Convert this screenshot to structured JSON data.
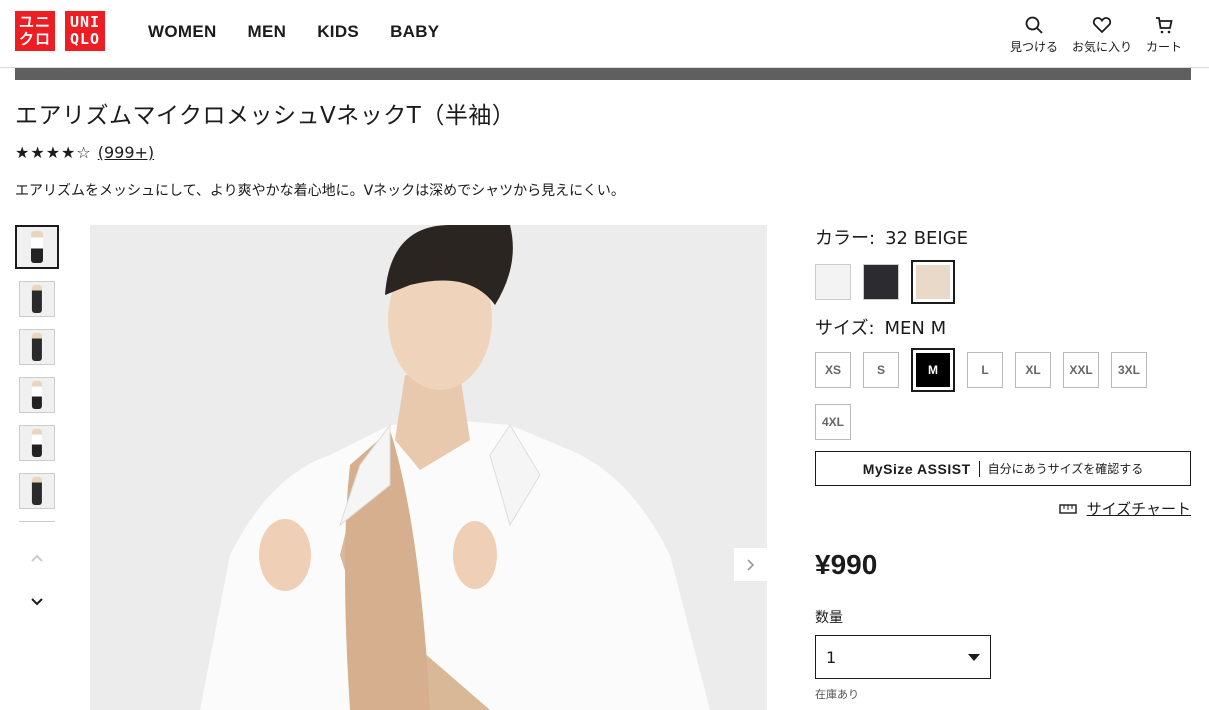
{
  "header": {
    "logo": {
      "line1_a": "ユニ",
      "line2_a": "クロ",
      "line1_b": "UNI",
      "line2_b": "QLO",
      "color": "#ed1d24"
    },
    "nav": [
      "WOMEN",
      "MEN",
      "KIDS",
      "BABY"
    ],
    "icons": [
      {
        "name": "search-icon",
        "label": "見つける"
      },
      {
        "name": "heart-icon",
        "label": "お気に入り"
      },
      {
        "name": "cart-icon",
        "label": "カート"
      }
    ]
  },
  "product": {
    "title": "エアリズムマイクロメッシュVネックT（半袖）",
    "stars": "★★★★☆",
    "rating": 4.5,
    "review_count": "(999+)",
    "description": "エアリズムをメッシュにして、より爽やかな着心地に。Vネックは深めでシャツから見えにくい。"
  },
  "color": {
    "label": "カラー:",
    "value": "32 BEIGE",
    "swatches": [
      {
        "hex": "#f3f3f3"
      },
      {
        "hex": "#2c2c30"
      },
      {
        "hex": "#e8d9c8"
      }
    ]
  },
  "size": {
    "label": "サイズ:",
    "value": "MEN M",
    "options": [
      "XS",
      "S",
      "M",
      "L",
      "XL",
      "XXL",
      "3XL",
      "4XL"
    ],
    "selected": "M"
  },
  "mysize": {
    "brand": "MySize ASSIST",
    "text": "自分にあうサイズを確認する"
  },
  "size_chart": "サイズチャート",
  "price": "¥990",
  "quantity": {
    "label": "数量",
    "value": "1"
  },
  "stock": "在庫あり"
}
